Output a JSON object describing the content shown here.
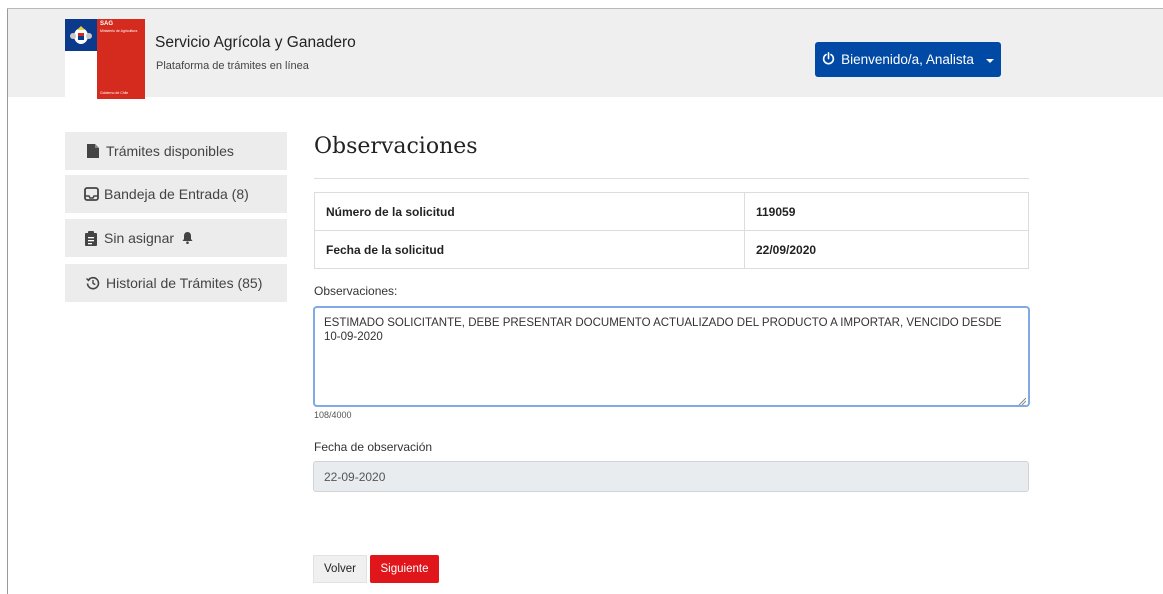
{
  "header": {
    "logo": {
      "sag": "SAG",
      "ministry": "Ministerio de Agricultura",
      "government": "Gobierno de Chile"
    },
    "org_title": "Servicio Agrícola y Ganadero",
    "org_subtitle": "Plataforma de trámites en línea",
    "user_menu_label": "Bienvenido/a, Analista"
  },
  "sidebar": {
    "items": [
      {
        "label": "Trámites disponibles",
        "icon": "file-icon"
      },
      {
        "label": "Bandeja de Entrada (8)",
        "icon": "inbox-icon"
      },
      {
        "label": "Sin asignar",
        "icon": "clipboard-icon",
        "badge_icon": "bell-icon"
      },
      {
        "label": "Historial de Trámites (85)",
        "icon": "history-icon"
      }
    ]
  },
  "main": {
    "title": "Observaciones",
    "info_rows": [
      {
        "label": "Número de la solicitud",
        "value": "119059"
      },
      {
        "label": "Fecha de la solicitud",
        "value": "22/09/2020"
      }
    ],
    "observations_label": "Observaciones:",
    "observations_value": "ESTIMADO SOLICITANTE, DEBE PRESENTAR DOCUMENTO ACTUALIZADO DEL PRODUCTO A IMPORTAR, VENCIDO DESDE 10-09-2020",
    "char_counter": "108/4000",
    "observation_date_label": "Fecha de observación",
    "observation_date_value": "22-09-2020",
    "back_label": "Volver",
    "next_label": "Siguiente"
  },
  "colors": {
    "primary_blue": "#0049a5",
    "danger_red": "#e0161a",
    "sidebar_bg": "#ececec",
    "header_bg": "#efefef"
  }
}
